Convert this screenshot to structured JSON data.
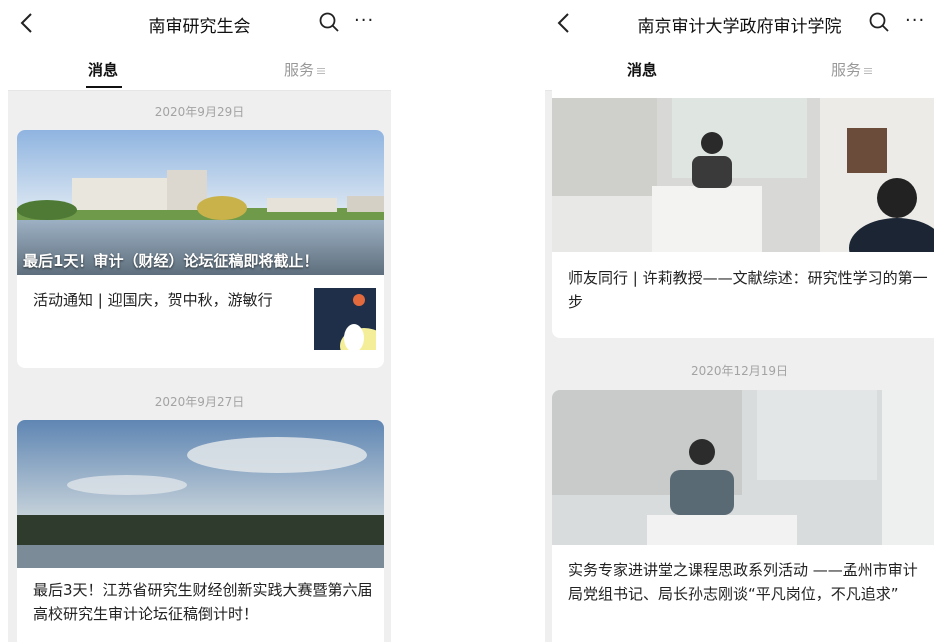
{
  "left": {
    "header": {
      "title": "南审研究生会"
    },
    "tabs": {
      "messages": "消息",
      "services": "服务"
    },
    "groups": [
      {
        "date": "2020年9月29日",
        "lead_title": "最后1天！审计（财经）论坛征稿即将截止！",
        "sub_title": "活动通知 | 迎国庆，贺中秋，游敏行"
      },
      {
        "date": "2020年9月27日",
        "title": "最后3天！江苏省研究生财经创新实践大赛暨第六届高校研究生审计论坛征稿倒计时！"
      }
    ]
  },
  "right": {
    "header": {
      "title": "南京审计大学政府审计学院"
    },
    "tabs": {
      "messages": "消息",
      "services": "服务"
    },
    "articles": [
      {
        "title": "师友同行 | 许莉教授——文献综述：研究性学习的第一步"
      },
      {
        "date": "2020年12月19日",
        "title": "实务专家进讲堂之课程思政系列活动 ——孟州市审计局党组书记、局长孙志刚谈“平凡岗位，不凡追求”"
      }
    ]
  },
  "icons": [
    "back-arrow-icon",
    "search-icon",
    "more-icon",
    "menu-lines-icon"
  ],
  "colors": {
    "background": "#efefef",
    "card": "#ffffff",
    "date_text": "#a3a3a3",
    "inactive_tab": "#999999"
  }
}
